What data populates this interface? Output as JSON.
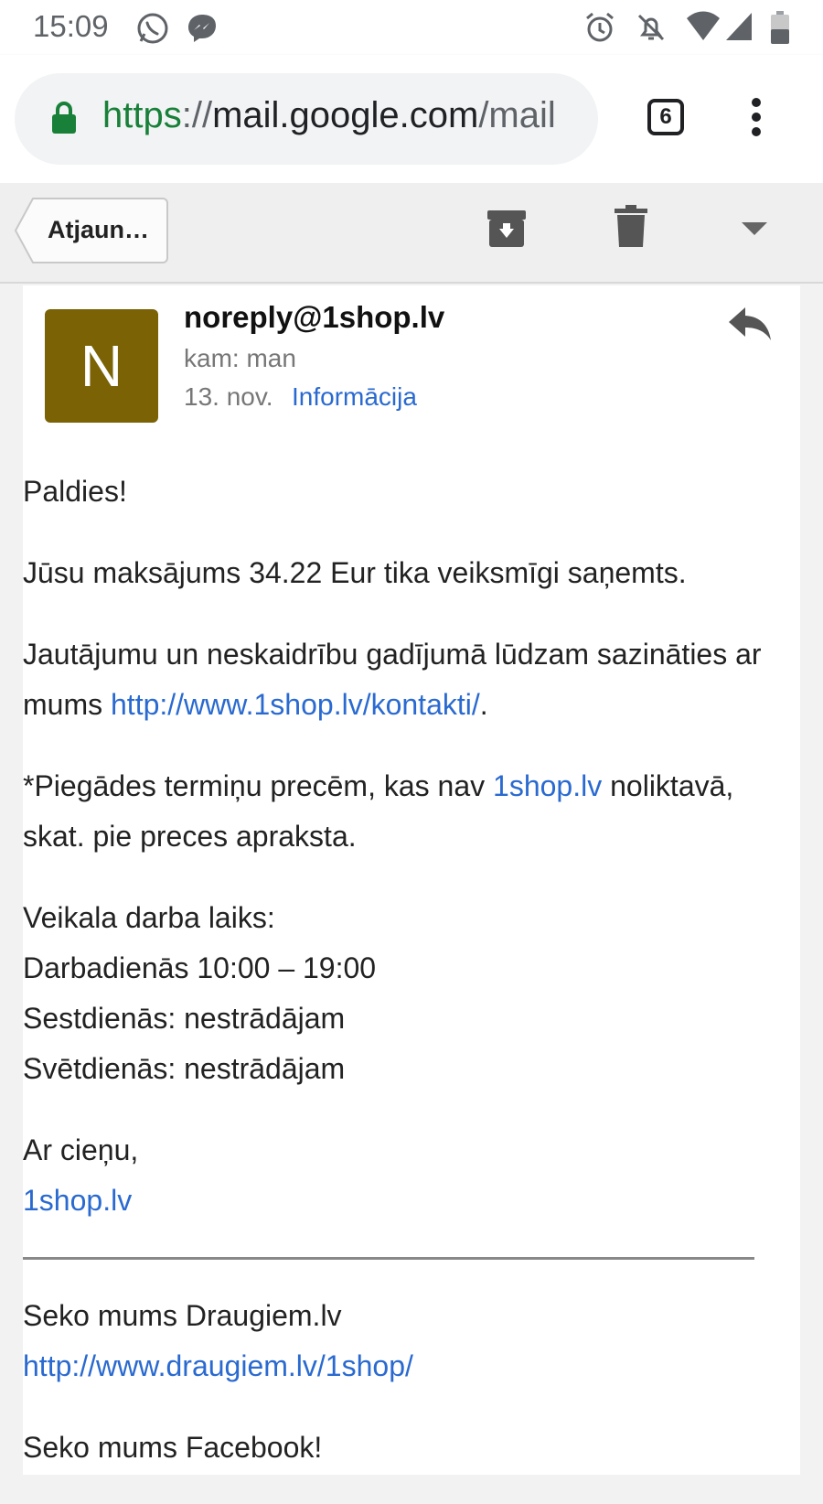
{
  "status_bar": {
    "time": "15:09",
    "icons": [
      "whatsapp-icon",
      "messenger-icon",
      "alarm-icon",
      "notifications-off-icon",
      "wifi-icon",
      "signal-icon",
      "battery-icon"
    ]
  },
  "browser": {
    "url_scheme": "https",
    "url_sep": "://",
    "url_host": "mail.google.com",
    "url_path": "/mail",
    "tab_count": "6"
  },
  "toolbar": {
    "back_label": "Atjaun…"
  },
  "message": {
    "avatar_letter": "N",
    "avatar_color": "#7a6205",
    "sender": "noreply@1shop.lv",
    "to": "kam: man",
    "date": "13. nov.",
    "label": "Informācija"
  },
  "body": {
    "greeting": "Paldies!",
    "payment": "Jūsu maksājums 34.22 Eur tika veiksmīgi saņemts.",
    "contact_text": "Jautājumu un neskaidrību gadījumā lūdzam sazināties ar mums ",
    "contact_link": "http://www.1shop.lv/kontakti/",
    "contact_end": ".",
    "delivery_text_1": "*Piegādes termiņu precēm, kas nav ",
    "delivery_link": "1shop.lv",
    "delivery_text_2": " noliktavā, skat. pie preces apraksta.",
    "hours_title": "Veikala darba laiks:",
    "hours_weekdays": "Darbadienās 10:00 – 19:00",
    "hours_saturday": "Sestdienās: nestrādājam",
    "hours_sunday": "Svētdienās: nestrādājam",
    "signoff": "Ar cieņu,",
    "signoff_link": "1shop.lv",
    "follow_draugiem": "Seko mums Draugiem.lv",
    "draugiem_link": "http://www.draugiem.lv/1shop/",
    "follow_facebook": "Seko mums Facebook!"
  }
}
